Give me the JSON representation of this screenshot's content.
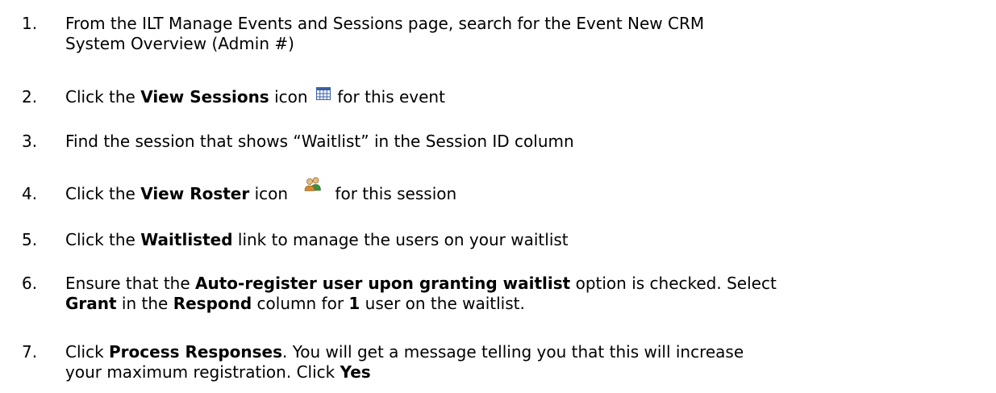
{
  "steps": [
    {
      "number": "1.",
      "line1": "From the ILT Manage Events and Sessions page, search for the Event New CRM",
      "line2": "System Overview (Admin #)"
    },
    {
      "number": "2.",
      "pre": "Click the ",
      "bold": "View Sessions",
      "mid": " icon",
      "icon": "calendar-grid-icon",
      "post": " for this event"
    },
    {
      "number": "3.",
      "text": "Find the session that shows “Waitlist” in the Session ID column"
    },
    {
      "number": "4.",
      "pre": "Click the ",
      "bold": "View Roster",
      "mid": " icon",
      "icon": "users-group-icon",
      "post": "for this session"
    },
    {
      "number": "5.",
      "pre": "Click the ",
      "bold": "Waitlisted",
      "post": " link to manage the users on your waitlist"
    },
    {
      "number": "6.",
      "l1_pre": "Ensure that the ",
      "l1_bold": "Auto-register user upon granting waitlist",
      "l1_post": " option is checked. Select",
      "l2_bold1": "Grant",
      "l2_text1": " in the ",
      "l2_bold2": "Respond",
      "l2_text2": " column for ",
      "l2_bold3": "1",
      "l2_text3": " user on the waitlist."
    },
    {
      "number": "7.",
      "l1_pre": "Click ",
      "l1_bold": "Process Responses",
      "l1_post": ".  You will get a message telling you that this will increase",
      "l2_text": "your maximum registration.  Click ",
      "l2_bold": "Yes"
    }
  ],
  "colors": {
    "text": "#000000",
    "background": "#ffffff",
    "icon_blue": "#3b5fa8",
    "icon_green": "#3f8f3a",
    "icon_orange": "#d08a2e"
  }
}
